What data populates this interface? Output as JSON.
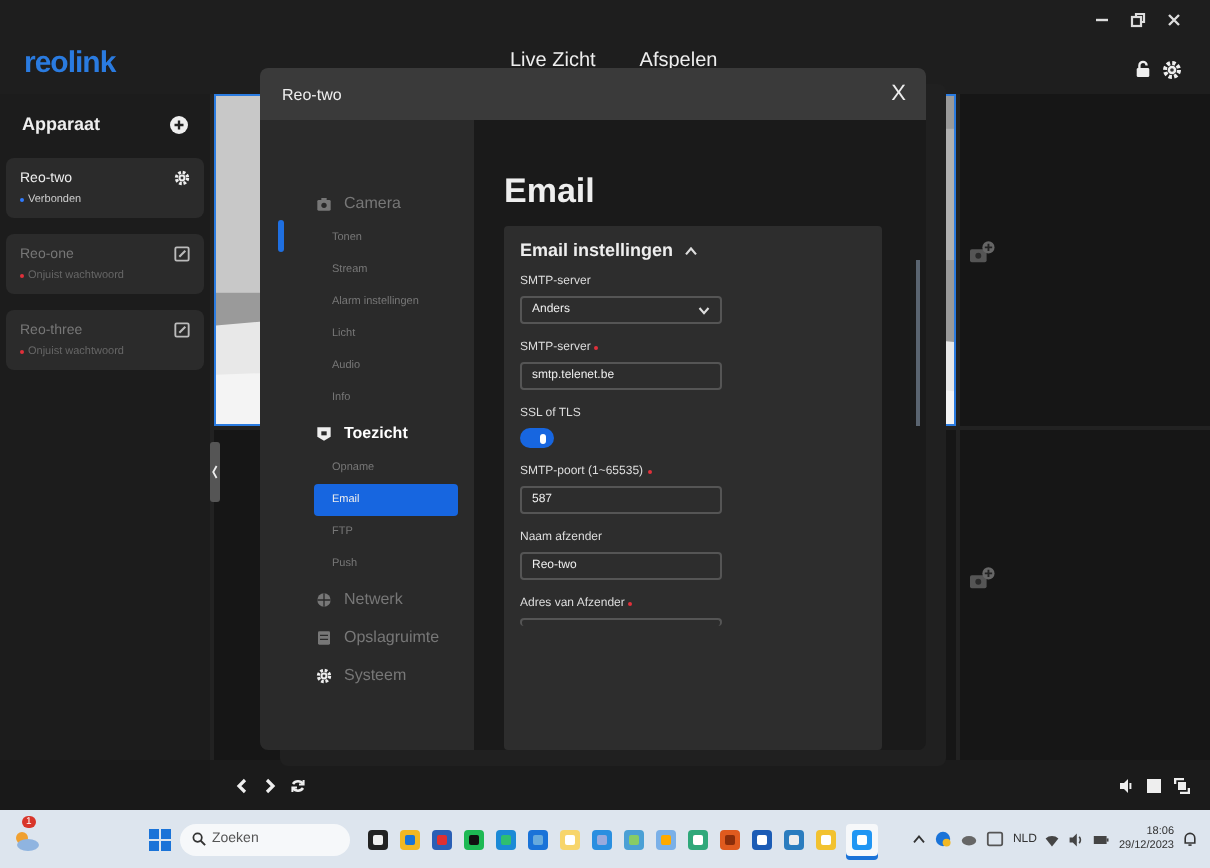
{
  "app": {
    "logo": "reolink",
    "nav": [
      "Live Zicht",
      "Afspelen"
    ]
  },
  "sidebar": {
    "title": "Apparaat",
    "devices": [
      {
        "name": "Reo-two",
        "status": "Verbonden",
        "color": "#2f7bff",
        "selected": true,
        "kind": "settings"
      },
      {
        "name": "Reo-one",
        "status": "Onjuist wachtwoord",
        "color": "#e0303a",
        "selected": false,
        "kind": "edit"
      },
      {
        "name": "Reo-three",
        "status": "Onjuist wachtwoord",
        "color": "#e0303a",
        "selected": false,
        "kind": "edit"
      }
    ]
  },
  "dialog": {
    "title": "Reo-two",
    "close": "X",
    "heading": "Email",
    "nav": [
      {
        "label": "Camera",
        "selected": false,
        "children": [
          {
            "label": "Tonen",
            "selected": false
          },
          {
            "label": "Stream",
            "selected": false
          },
          {
            "label": "Alarm instellingen",
            "selected": false
          },
          {
            "label": "Licht",
            "selected": false
          },
          {
            "label": "Audio",
            "selected": false
          },
          {
            "label": "Info",
            "selected": false
          }
        ]
      },
      {
        "label": "Toezicht",
        "selected": true,
        "children": [
          {
            "label": "Opname",
            "selected": false
          },
          {
            "label": "Email",
            "selected": true
          },
          {
            "label": "FTP",
            "selected": false
          },
          {
            "label": "Push",
            "selected": false
          }
        ]
      },
      {
        "label": "Netwerk",
        "selected": false
      },
      {
        "label": "Opslagruimte",
        "selected": false
      },
      {
        "label": "Systeem",
        "selected": false
      }
    ],
    "section": {
      "title": "Email instellingen",
      "expanded": true,
      "fields": [
        {
          "kind": "select",
          "label": "SMTP-server",
          "required": false,
          "value": "Anders"
        },
        {
          "kind": "text",
          "label": "SMTP-server",
          "required": true,
          "value": "smtp.telenet.be"
        },
        {
          "kind": "toggle",
          "label": "SSL of TLS",
          "required": false,
          "on": true
        },
        {
          "kind": "text",
          "label": "SMTP-poort (1~65535)",
          "required": true,
          "value": "587"
        },
        {
          "kind": "text",
          "label": "Naam afzender",
          "required": false,
          "value": "Reo-two"
        },
        {
          "kind": "cut",
          "label": "Adres van Afzender",
          "required": true
        }
      ]
    }
  },
  "taskbar": {
    "weather_badge": "1",
    "search": {
      "placeholder": "Zoeken"
    },
    "language": "NLD",
    "time": "18:06",
    "date": "29/12/2023"
  }
}
